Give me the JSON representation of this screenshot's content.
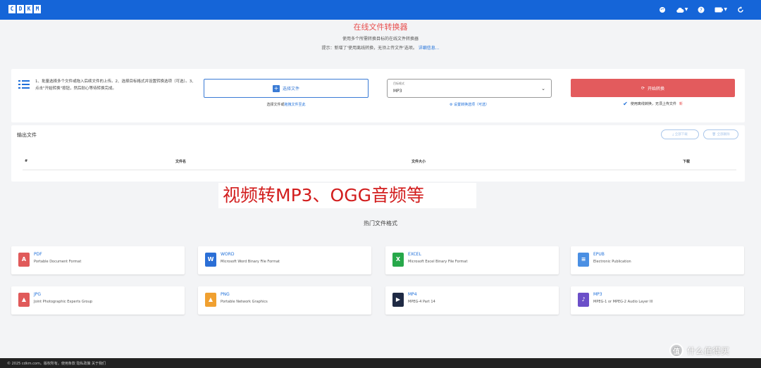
{
  "header": {
    "logo_letters": [
      "C",
      "D",
      "K",
      "M"
    ],
    "icons": [
      "palette-icon",
      "cloud-icon",
      "help-icon",
      "battery-icon",
      "refresh-icon"
    ]
  },
  "hero": {
    "title": "在线文件转换器",
    "subtitle": "使用多个所需转换目标的在线文件转换器",
    "hint_prefix": "提示：新增了'使用离线转换，无须上传文件'选项。",
    "hint_link": "详细信息..."
  },
  "upload": {
    "steps": "1、批量选择多个文件或拖入后续文件的上传。2、选择目标格式并设置转换选项（可选）。3、点击\"开始转换\"按钮，然后耐心等待转换完成。",
    "select_button": "选择文件",
    "select_hint_prefix": "选择文件或",
    "select_hint_link": "拖拽文件至此",
    "format_label": "目标格式",
    "format_value": "MP3",
    "format_hint": "设置转换选项（可选）",
    "convert_button": "开始转换",
    "convert_hint": "使用离线转换，无须上传文件",
    "convert_hint_tag": "新"
  },
  "output": {
    "title": "输出文件",
    "btn_download_all": "全部下载",
    "btn_delete_all": "全部删除",
    "columns": [
      "#",
      "文件名",
      "文件大小",
      "下载"
    ]
  },
  "overlay_note": "视频转MP3、OGG音频等",
  "popular": {
    "title": "热门文件格式",
    "formats": [
      {
        "name": "PDF",
        "desc": "Portable Document Format",
        "color": "#e05a5a",
        "glyph": "A"
      },
      {
        "name": "WORD",
        "desc": "Microsoft Word Binary File Format",
        "color": "#2b6fd6",
        "glyph": "W"
      },
      {
        "name": "EXCEL",
        "desc": "Microsoft Excel Binary File Format",
        "color": "#27a84a",
        "glyph": "X"
      },
      {
        "name": "EPUB",
        "desc": "Electronic Publication",
        "color": "#4a8fe3",
        "glyph": "≡"
      },
      {
        "name": "JPG",
        "desc": "Joint Photographic Experts Group",
        "color": "#e05a5a",
        "glyph": "▲"
      },
      {
        "name": "PNG",
        "desc": "Portable Network Graphics",
        "color": "#f0a030",
        "glyph": "▲"
      },
      {
        "name": "MP4",
        "desc": "MPEG-4 Part 14",
        "color": "#1f2a44",
        "glyph": "▶"
      },
      {
        "name": "MP3",
        "desc": "MPEG-1 or MPEG-2 Audio Layer III",
        "color": "#6b4fc8",
        "glyph": "♪"
      }
    ]
  },
  "footer": {
    "text": "© 2025 cdkm.com。版权所有。使用条款  隐私政策  关于我们"
  },
  "watermark": {
    "text": "什么值得买",
    "badge": "值"
  }
}
